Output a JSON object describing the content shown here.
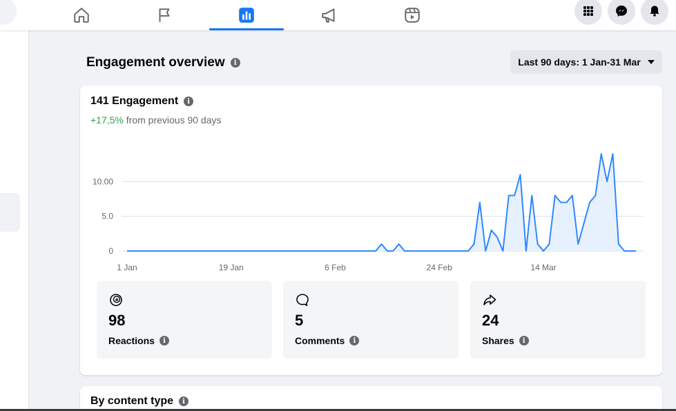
{
  "nav": {
    "tabs": [
      {
        "icon": "home-icon"
      },
      {
        "icon": "flag-icon"
      },
      {
        "icon": "insights-icon",
        "active": true
      },
      {
        "icon": "megaphone-icon"
      },
      {
        "icon": "reels-icon"
      }
    ],
    "right_buttons": [
      "apps-grid-icon",
      "messenger-icon",
      "notifications-bell-icon"
    ],
    "accent_color": "#1877f2"
  },
  "overview": {
    "title": "Engagement overview",
    "date_range": "Last 90 days: 1 Jan-31 Mar"
  },
  "engagement": {
    "title": "141 Engagement",
    "delta": "+17,5%",
    "delta_suffix": " from previous 90 days",
    "delta_color": "#31a24c"
  },
  "chart_data": {
    "type": "area",
    "title": "",
    "xlabel": "",
    "ylabel": "",
    "x_tick_labels": [
      "1 Jan",
      "19 Jan",
      "6 Feb",
      "24 Feb",
      "14 Mar"
    ],
    "y_tick_labels": [
      "0",
      "5.0",
      "10.00"
    ],
    "ylim": [
      0,
      15
    ],
    "line_color": "#2d88ff",
    "fill_color": "#e7f0fd",
    "series": [
      {
        "values": [
          0,
          0,
          0,
          0,
          0,
          0,
          0,
          0,
          0,
          0,
          0,
          0,
          0,
          0,
          0,
          0,
          0,
          0,
          0,
          0,
          0,
          0,
          0,
          0,
          0,
          0,
          0,
          0,
          0,
          0,
          0,
          0,
          0,
          0,
          0,
          0,
          0,
          0,
          0,
          0,
          0,
          0,
          0,
          0,
          1,
          0,
          0,
          1,
          0,
          0,
          0,
          0,
          0,
          0,
          0,
          0,
          0,
          0,
          0,
          0,
          1,
          7,
          0,
          3,
          2,
          0,
          8,
          8,
          11,
          0,
          8,
          1,
          0,
          1,
          8,
          7,
          7,
          8,
          1,
          4,
          7,
          8,
          14,
          10,
          14,
          1,
          0,
          0,
          0
        ]
      }
    ]
  },
  "stats": [
    {
      "icon": "reactions-icon",
      "value": "98",
      "label": "Reactions"
    },
    {
      "icon": "comment-icon",
      "value": "5",
      "label": "Comments"
    },
    {
      "icon": "share-icon",
      "value": "24",
      "label": "Shares"
    }
  ],
  "content_type": {
    "title": "By content type"
  }
}
